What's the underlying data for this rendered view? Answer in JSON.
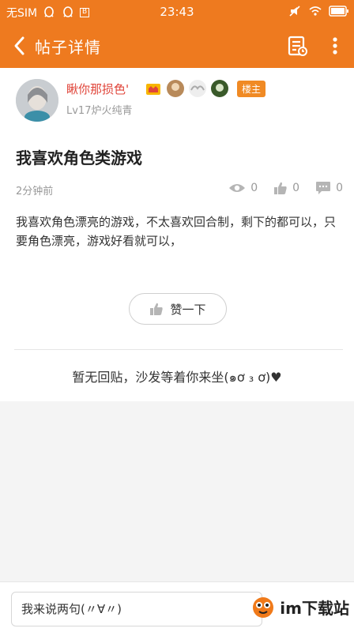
{
  "status_bar": {
    "carrier": "无SIM",
    "time": "23:43"
  },
  "header": {
    "title": "帖子详情",
    "back_icon": "back-arrow-icon",
    "list_icon": "post-list-icon",
    "more_icon": "more-vertical-icon"
  },
  "author": {
    "name": "瞅你那损色'",
    "level": "Lv17炉火纯青",
    "role_badge": "楼主"
  },
  "post": {
    "title": "我喜欢角色类游戏",
    "time": "2分钟前",
    "views": "0",
    "likes": "0",
    "comments": "0",
    "body": "我喜欢角色漂亮的游戏，不太喜欢回合制，剩下的都可以，只要角色漂亮，游戏好看就可以，"
  },
  "like_button": {
    "label": "赞一下"
  },
  "replies": {
    "empty_text": "暂无回贴，沙发等着你来坐(๑ơ ₃ ơ)♥"
  },
  "composer": {
    "placeholder": "我来说两句(〃∀〃)"
  },
  "watermark": "im下载站",
  "colors": {
    "accent": "#ee7a1f",
    "author_name": "#e0453a"
  }
}
